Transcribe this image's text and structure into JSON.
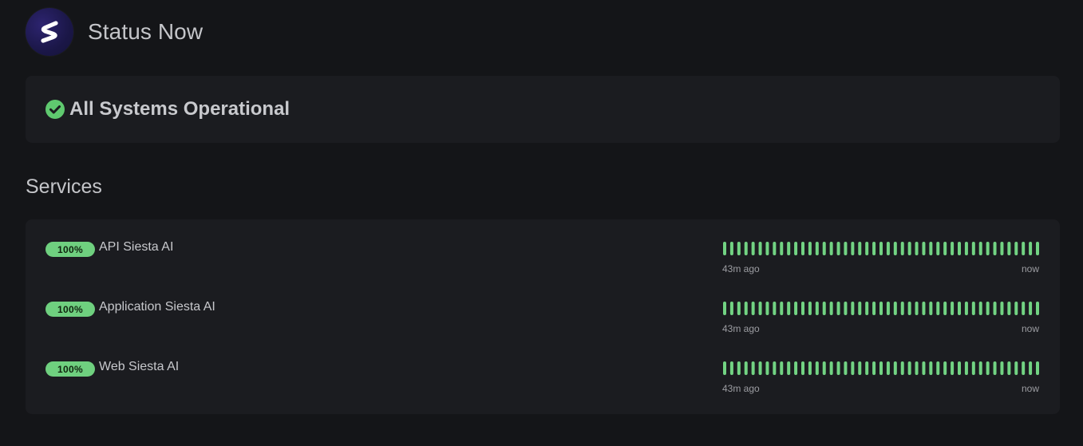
{
  "app": {
    "title": "Status Now",
    "logo_icon": "s-logo-icon"
  },
  "overall_status": {
    "text": "All Systems Operational",
    "icon": "check-circle-icon",
    "color": "#5fc96f"
  },
  "services_section": {
    "title": "Services",
    "timeline_start": "43m ago",
    "timeline_end": "now",
    "bar_color": "#72d383",
    "bar_count": 45,
    "items": [
      {
        "uptime": "100%",
        "name": "API Siesta AI"
      },
      {
        "uptime": "100%",
        "name": "Application Siesta AI"
      },
      {
        "uptime": "100%",
        "name": "Web Siesta AI"
      }
    ]
  }
}
